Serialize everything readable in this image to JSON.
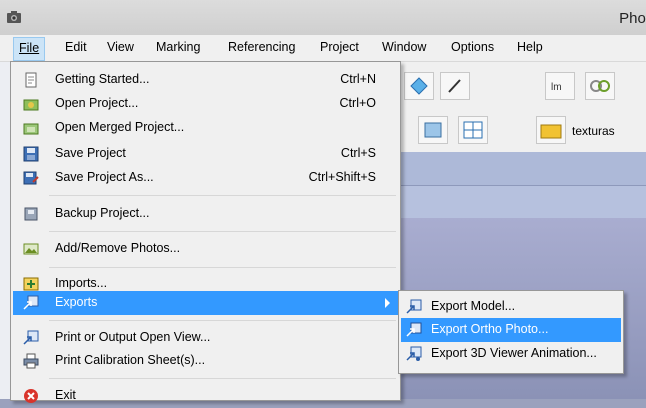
{
  "window": {
    "title": "Phot"
  },
  "menubar": {
    "items": [
      {
        "label": "File"
      },
      {
        "label": "Edit"
      },
      {
        "label": "View"
      },
      {
        "label": "Marking"
      },
      {
        "label": "Referencing"
      },
      {
        "label": "Project"
      },
      {
        "label": "Window"
      },
      {
        "label": "Options"
      },
      {
        "label": "Help"
      }
    ]
  },
  "toolbar": {
    "texture_label": "texturas"
  },
  "file_menu": {
    "items": [
      {
        "label": "Getting Started...",
        "shortcut": "Ctrl+N",
        "icon": "getting-started-icon"
      },
      {
        "label": "Open Project...",
        "shortcut": "Ctrl+O",
        "icon": "open-project-icon"
      },
      {
        "label": "Open Merged Project...",
        "shortcut": "",
        "icon": "open-merged-icon"
      },
      {
        "label": "Save Project",
        "shortcut": "Ctrl+S",
        "icon": "save-icon"
      },
      {
        "label": "Save Project As...",
        "shortcut": "Ctrl+Shift+S",
        "icon": "save-as-icon"
      },
      {
        "label": "Backup Project...",
        "shortcut": "",
        "icon": "backup-icon"
      },
      {
        "label": "Add/Remove Photos...",
        "shortcut": "",
        "icon": "photos-icon"
      },
      {
        "label": "Imports...",
        "shortcut": "",
        "icon": "imports-icon"
      },
      {
        "label": "Exports",
        "shortcut": "",
        "icon": "exports-icon"
      },
      {
        "label": "Print or Output Open View...",
        "shortcut": "",
        "icon": "print-view-icon"
      },
      {
        "label": "Print Calibration Sheet(s)...",
        "shortcut": "",
        "icon": "printer-icon"
      },
      {
        "label": "Exit",
        "shortcut": "",
        "icon": "exit-icon"
      }
    ]
  },
  "exports_submenu": {
    "items": [
      {
        "label": "Export Model...",
        "icon": "export-model-icon"
      },
      {
        "label": "Export Ortho Photo...",
        "icon": "export-ortho-icon"
      },
      {
        "label": "Export 3D Viewer Animation...",
        "icon": "export-animation-icon"
      }
    ]
  },
  "colors": {
    "highlight": "#3399ff",
    "menu_bg": "#f0f0f0",
    "workspace": "#9aa1bd"
  }
}
